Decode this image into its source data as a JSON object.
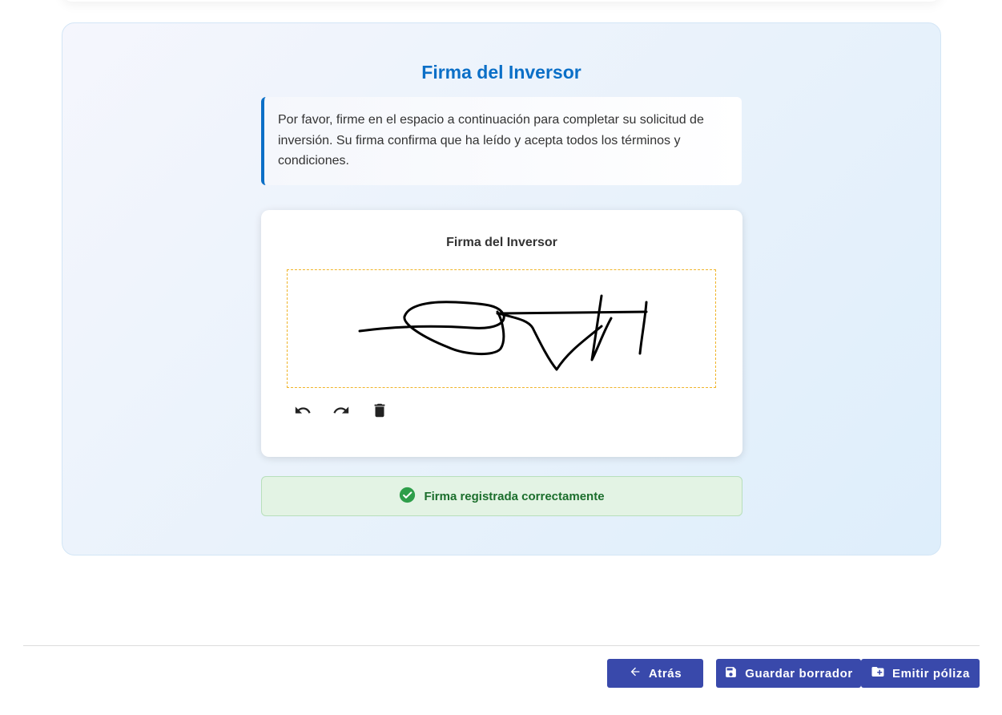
{
  "section": {
    "title": "Firma del Inversor",
    "instructions": "Por favor, firme en el espacio a continuación para completar su solicitud de inversión. Su firma confirma que ha leído y acepta todos los términos y condiciones."
  },
  "signature_pad": {
    "label": "Firma del Inversor",
    "tools": [
      {
        "name": "undo",
        "icon": "undo-icon"
      },
      {
        "name": "redo",
        "icon": "redo-icon"
      },
      {
        "name": "clear",
        "icon": "trash-icon"
      }
    ]
  },
  "status": {
    "message": "Firma registrada correctamente",
    "icon": "check-circle-icon",
    "color": "#2e9e4a"
  },
  "footer": {
    "back_label": "Atrás",
    "save_label": "Guardar borrador",
    "emit_label": "Emitir póliza"
  },
  "colors": {
    "accent": "#0b6fc7",
    "button": "#3949ab",
    "success_bg": "#e3f3e4",
    "success_text": "#1b6e2c"
  }
}
